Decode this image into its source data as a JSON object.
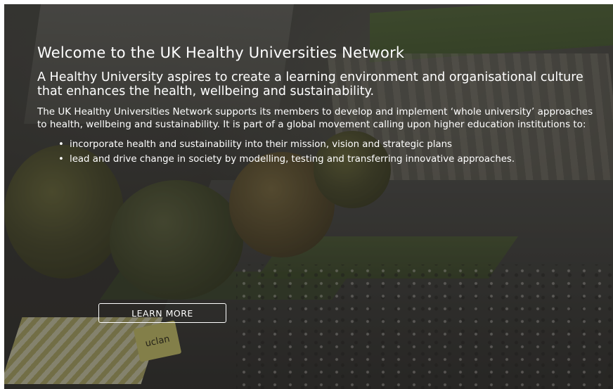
{
  "hero": {
    "title": "Welcome to the UK Healthy Universities Network",
    "tagline": "A Healthy University aspires to create a learning environment and organisational culture that enhances the health, wellbeing and sustainability.",
    "intro": "The UK Healthy Universities Network supports its members to develop and implement ‘whole university’ approaches to health, wellbeing and sustainability. It is part of a global movement calling upon higher education institutions to:",
    "goals": [
      {
        "bullet": "•",
        "text": "incorporate health and sustainability into their mission, vision and strategic plans"
      },
      {
        "bullet": "•",
        "text": "lead and drive change in society by modelling, testing and transferring innovative approaches."
      }
    ],
    "cta_label": "LEARN MORE",
    "background": {
      "description_icon": "campus-aerial-photo",
      "sign_text": "uclan"
    }
  },
  "colors": {
    "text": "#ffffff",
    "overlay": "#141414"
  }
}
